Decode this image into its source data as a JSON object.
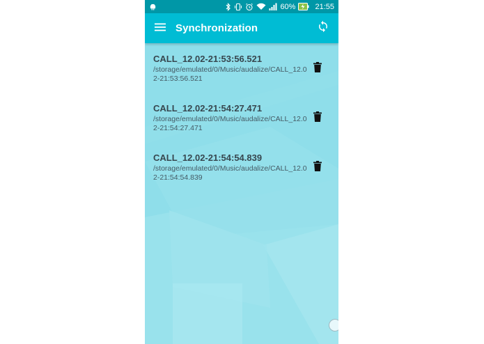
{
  "statusbar": {
    "battery_percent": "60%",
    "time": "21:55",
    "icons": [
      "android-icon",
      "bluetooth-icon",
      "vibrate-icon",
      "alarm-icon",
      "wifi-icon",
      "signal-icon",
      "battery-charging-icon"
    ]
  },
  "appbar": {
    "title": "Synchronization",
    "menu_icon": "hamburger-menu-icon",
    "sync_icon": "sync-icon"
  },
  "recordings": [
    {
      "name": "CALL_12.02-21:53:56.521",
      "path": "/storage/emulated/0/Music/audalize/CALL_12.02-21:53:56.521",
      "action_icon": "trash-icon"
    },
    {
      "name": "CALL_12.02-21:54:27.471",
      "path": "/storage/emulated/0/Music/audalize/CALL_12.02-21:54:27.471",
      "action_icon": "trash-icon"
    },
    {
      "name": "CALL_12.02-21:54:54.839",
      "path": "/storage/emulated/0/Music/audalize/CALL_12.02-21:54:54.839",
      "action_icon": "trash-icon"
    }
  ],
  "colors": {
    "statusbar": "#0097a7",
    "appbar": "#00bcd4",
    "background": "#8fdeea",
    "item_text": "#37474f"
  }
}
